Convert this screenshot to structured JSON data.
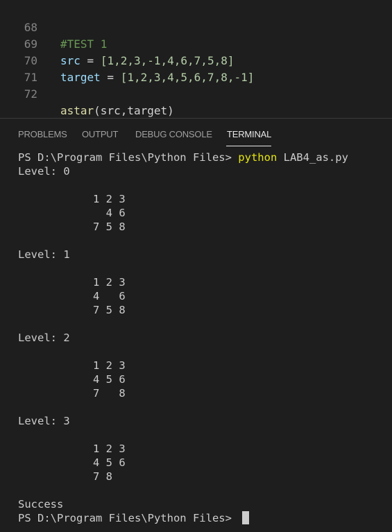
{
  "editor": {
    "lines": [
      {
        "num": "68",
        "text": "#TEST 1"
      },
      {
        "num": "69",
        "var": "src",
        "op": " = ",
        "value": "[1,2,3,-1,4,6,7,5,8]"
      },
      {
        "num": "70",
        "var": "target",
        "op": " = ",
        "value": "[1,2,3,4,5,6,7,8,-1]"
      },
      {
        "num": "71",
        "text": ""
      },
      {
        "num": "72",
        "fn": "astar",
        "args": "(src,target)"
      }
    ]
  },
  "panel": {
    "tabs": [
      {
        "label": "PROBLEMS"
      },
      {
        "label": "OUTPUT"
      },
      {
        "label": "DEBUG CONSOLE"
      },
      {
        "label": "TERMINAL",
        "active": true
      }
    ]
  },
  "terminal": {
    "prompt": "PS D:\\Program Files\\Python Files> ",
    "command": "python",
    "command_args": " LAB4_as.py",
    "levels": [
      {
        "label": "Level: 0",
        "rows": [
          "1 2 3",
          "  4 6",
          "7 5 8"
        ]
      },
      {
        "label": "Level: 1",
        "rows": [
          "1 2 3",
          "4   6",
          "7 5 8"
        ]
      },
      {
        "label": "Level: 2",
        "rows": [
          "1 2 3",
          "4 5 6",
          "7   8"
        ]
      },
      {
        "label": "Level: 3",
        "rows": [
          "1 2 3",
          "4 5 6",
          "7 8"
        ]
      }
    ],
    "result": "Success",
    "final_prompt": "PS D:\\Program Files\\Python Files> "
  }
}
